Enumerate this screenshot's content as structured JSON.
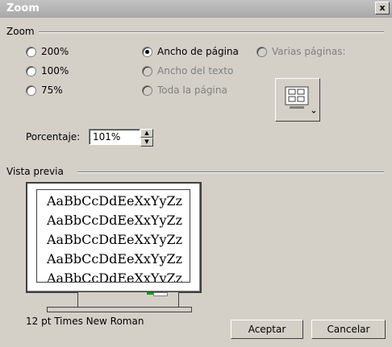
{
  "window": {
    "title": "Zoom",
    "close": "x"
  },
  "zoom_group": {
    "label": "Zoom"
  },
  "radios": {
    "r200": {
      "label": "200%",
      "checked": false,
      "disabled": false
    },
    "r100": {
      "label": "100%",
      "checked": false,
      "disabled": false
    },
    "r75": {
      "label": "75%",
      "checked": false,
      "disabled": false
    },
    "page_width": {
      "label": "Ancho de página",
      "checked": true,
      "disabled": false
    },
    "text_width": {
      "label": "Ancho del texto",
      "checked": false,
      "disabled": true
    },
    "whole_page": {
      "label": "Toda la página",
      "checked": false,
      "disabled": true
    },
    "many_pages": {
      "label": "Varias páginas:",
      "checked": false,
      "disabled": true
    }
  },
  "percent": {
    "label": "Porcentaje:",
    "value": "101%"
  },
  "preview_group": {
    "label": "Vista previa"
  },
  "preview": {
    "sample_lines": [
      "AaBbCcDdEeXxYyZz",
      "AaBbCcDdEeXxYyZz",
      "AaBbCcDdEeXxYyZz",
      "AaBbCcDdEeXxYyZz",
      "AaBbCcDdEeXxYyZz"
    ],
    "font_description": "12 pt Times New Roman"
  },
  "buttons": {
    "ok": "Aceptar",
    "cancel": "Cancelar"
  }
}
